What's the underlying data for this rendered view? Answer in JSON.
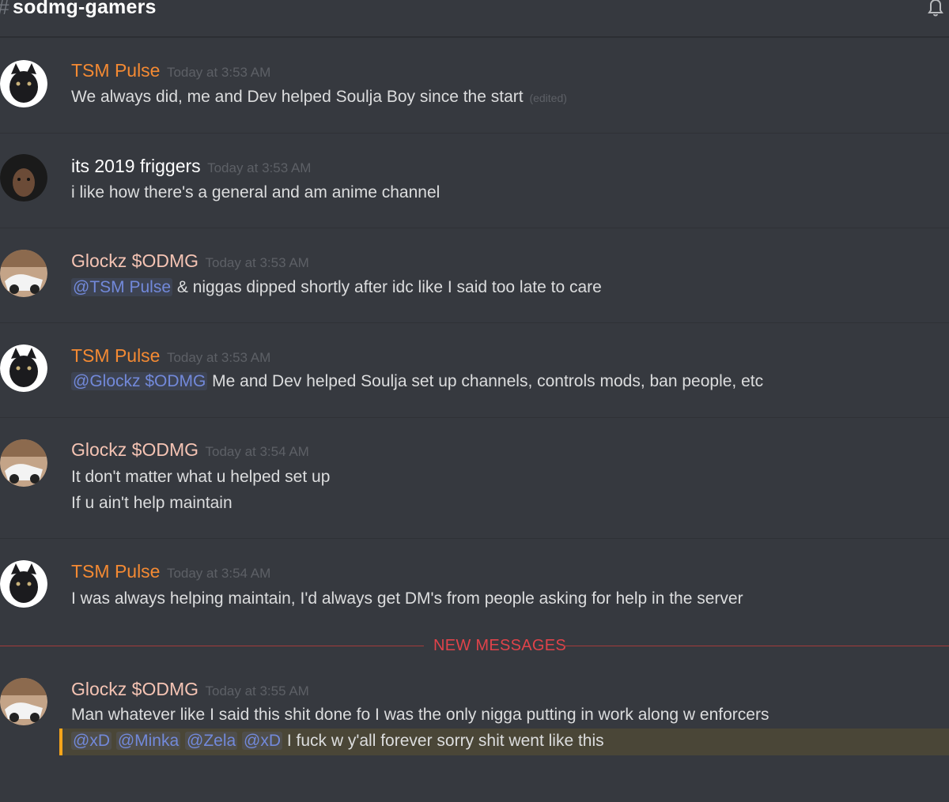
{
  "header": {
    "hash": "#",
    "channel": "sodmg-gamers",
    "bell_icon": "bell-icon"
  },
  "colors": {
    "background": "#36393f",
    "tsm_pulse": "#f48a33",
    "glockz": "#f5c4b4",
    "its2019": "#ffffff",
    "mention": "#7289da",
    "new_messages": "#e0434a",
    "highlight_bar": "#faa61a"
  },
  "messages": [
    {
      "author": "TSM Pulse",
      "timestamp": "Today at 3:53 AM",
      "lines": [
        {
          "text": "We always did, me and Dev helped Soulja Boy since the start",
          "edited": "(edited)"
        }
      ]
    },
    {
      "author": "its 2019 friggers",
      "timestamp": "Today at 3:53 AM",
      "lines": [
        {
          "text": "i like how there's a general and am anime channel"
        }
      ]
    },
    {
      "author": "Glockz $ODMG",
      "timestamp": "Today at 3:53 AM",
      "lines": [
        {
          "mention": "@TSM Pulse",
          "text": " & niggas dipped shortly after idc like I said too late to care"
        }
      ]
    },
    {
      "author": "TSM Pulse",
      "timestamp": "Today at 3:53 AM",
      "lines": [
        {
          "mention": "@Glockz $ODMG",
          "text": " Me and Dev helped Soulja set up channels, controls mods, ban people, etc"
        }
      ]
    },
    {
      "author": "Glockz $ODMG",
      "timestamp": "Today at 3:54 AM",
      "lines": [
        {
          "text": "It don't matter what u helped set up"
        },
        {
          "text": "If u ain't help maintain"
        }
      ]
    },
    {
      "author": "TSM Pulse",
      "timestamp": "Today at 3:54 AM",
      "lines": [
        {
          "text": "I was always helping maintain, I'd always get DM's from people asking for help in the server"
        }
      ]
    },
    {
      "author": "Glockz $ODMG",
      "timestamp": "Today at 3:55 AM",
      "lines": [
        {
          "text": "Man whatever like I said this shit done fo I was the only nigga putting in work along w enforcers"
        },
        {
          "mentions": [
            "@xD",
            "@Minka",
            "@Zela",
            "@xD"
          ],
          "text": " I fuck w y'all forever sorry shit went like this"
        }
      ]
    }
  ],
  "new_messages_label": "NEW MESSAGES"
}
